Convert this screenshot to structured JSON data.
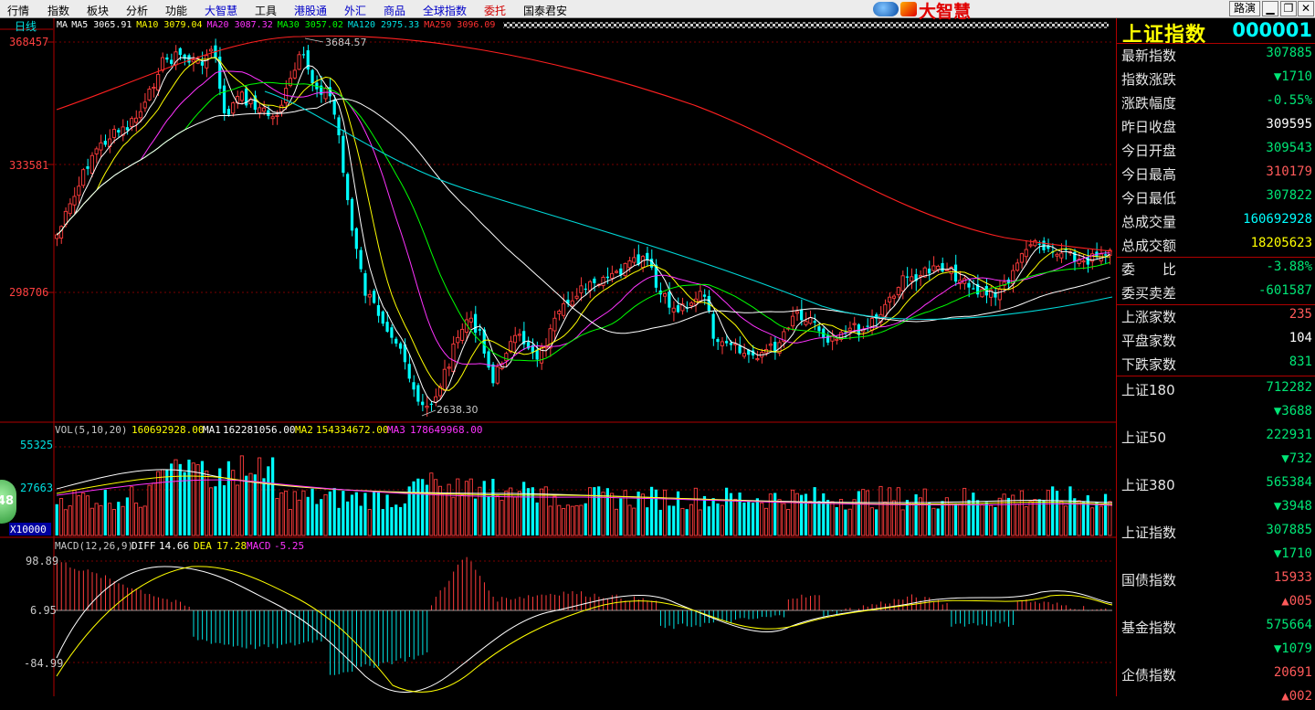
{
  "menu": {
    "items": [
      {
        "label": "行情",
        "style": "normal"
      },
      {
        "label": "指数",
        "style": "normal"
      },
      {
        "label": "板块",
        "style": "normal"
      },
      {
        "label": "分析",
        "style": "normal"
      },
      {
        "label": "功能",
        "style": "normal"
      },
      {
        "label": "大智慧",
        "style": "blue"
      },
      {
        "label": "工具",
        "style": "normal"
      },
      {
        "label": "港股通",
        "style": "blue"
      },
      {
        "label": "外汇",
        "style": "blue"
      },
      {
        "label": "商品",
        "style": "blue"
      },
      {
        "label": "全球指数",
        "style": "blue"
      },
      {
        "label": "委托",
        "style": "red"
      },
      {
        "label": "国泰君安",
        "style": "normal"
      }
    ],
    "brand": "大智慧",
    "route_button": "路演",
    "min_icon": "minimize-icon",
    "restore_icon": "restore-icon",
    "close_icon": "close-icon"
  },
  "price_panel": {
    "period": "日线",
    "ma_legend": [
      {
        "label": "MA",
        "color": "#ffffff"
      },
      {
        "label": "MA5",
        "value": "3065.91",
        "color": "#ffffff"
      },
      {
        "label": "MA10",
        "value": "3079.04",
        "color": "#ffff00"
      },
      {
        "label": "MA20",
        "value": "3087.32",
        "color": "#ff33ff"
      },
      {
        "label": "MA30",
        "value": "3057.02",
        "color": "#00ff00"
      },
      {
        "label": "MA120",
        "value": "2975.33",
        "color": "#00e0e0"
      },
      {
        "label": "MA250",
        "value": "3096.09",
        "color": "#ff3030"
      }
    ],
    "y_labels": [
      "368457",
      "333581",
      "298706"
    ],
    "peak_annotation": "3684.57",
    "trough_annotation": "2638.30"
  },
  "volume_panel": {
    "legend_title": "VOL(5,10,20)",
    "legend_vol": "160692928.00",
    "legend_ma1_label": "MA1",
    "legend_ma1": "162281056.00",
    "legend_ma2_label": "MA2",
    "legend_ma2": "154334672.00",
    "legend_ma3_label": "MA3",
    "legend_ma3": "178649968.00",
    "y_labels": [
      "55325",
      "27663"
    ],
    "unit": "X10000",
    "badge": "48"
  },
  "macd_panel": {
    "legend_title": "MACD(12,26,9)",
    "diff_label": "DIFF",
    "diff": "14.66",
    "dea_label": "DEA",
    "dea": "17.28",
    "macd_label": "MACD",
    "macd": "-5.25",
    "y_labels": [
      "98.89",
      "6.95",
      "-84.99"
    ]
  },
  "quote": {
    "name": "上证指数",
    "code": "000001",
    "rows": [
      {
        "label": "最新指数",
        "value": "307885",
        "cls": "dn"
      },
      {
        "label": "指数涨跌",
        "value": "▼1710",
        "cls": "dn"
      },
      {
        "label": "涨跌幅度",
        "value": "-0.55%",
        "cls": "dn"
      },
      {
        "label": "昨日收盘",
        "value": "309595",
        "cls": "wh"
      },
      {
        "label": "今日开盘",
        "value": "309543",
        "cls": "dn"
      },
      {
        "label": "今日最高",
        "value": "310179",
        "cls": "up"
      },
      {
        "label": "今日最低",
        "value": "307822",
        "cls": "dn"
      },
      {
        "label": "总成交量",
        "value": "160692928",
        "cls": "cy"
      },
      {
        "label": "总成交额",
        "value": "18205623",
        "cls": "yl"
      },
      {
        "label": "委　　比",
        "value": "-3.88%",
        "cls": "dn"
      },
      {
        "label": "委买卖差",
        "value": "-601587",
        "cls": "dn"
      },
      {
        "label": "上涨家数",
        "value": "235",
        "cls": "up"
      },
      {
        "label": "平盘家数",
        "value": "104",
        "cls": "wh"
      },
      {
        "label": "下跌家数",
        "value": "831",
        "cls": "dn"
      }
    ],
    "indices": [
      {
        "label": "上证180",
        "value": "712282",
        "cls": "dn",
        "change": "▼3688",
        "change_cls": "dn"
      },
      {
        "label": "上证50",
        "value": "222931",
        "cls": "dn",
        "change": "▼732",
        "change_cls": "dn"
      },
      {
        "label": "上证380",
        "value": "565384",
        "cls": "dn",
        "change": "▼3948",
        "change_cls": "dn"
      },
      {
        "label": "上证指数",
        "value": "307885",
        "cls": "dn",
        "change": "▼1710",
        "change_cls": "dn"
      },
      {
        "label": "国债指数",
        "value": "15933",
        "cls": "up",
        "change": "▲005",
        "change_cls": "up"
      },
      {
        "label": "基金指数",
        "value": "575664",
        "cls": "dn",
        "change": "▼1079",
        "change_cls": "dn"
      },
      {
        "label": "企债指数",
        "value": "20691",
        "cls": "up",
        "change": "▲002",
        "change_cls": "up"
      }
    ]
  }
}
